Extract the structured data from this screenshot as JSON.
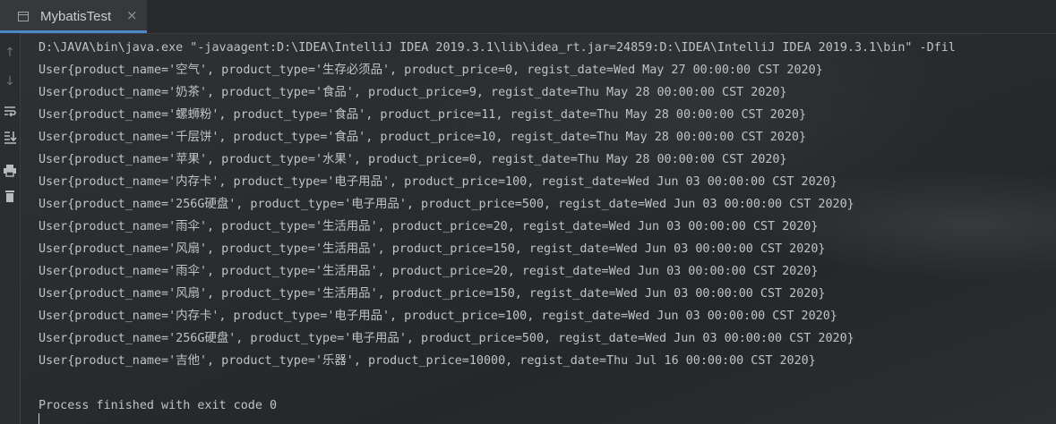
{
  "tab": {
    "label": "MybatisTest",
    "close": "×"
  },
  "gutter": {
    "icons": [
      "arrow-up-icon",
      "arrow-down-icon",
      "soft-wrap-icon",
      "scroll-to-end-icon",
      "print-icon",
      "trash-icon"
    ]
  },
  "console": {
    "command": "D:\\JAVA\\bin\\java.exe \"-javaagent:D:\\IDEA\\IntelliJ IDEA 2019.3.1\\lib\\idea_rt.jar=24859:D:\\IDEA\\IntelliJ IDEA 2019.3.1\\bin\" -Dfil",
    "output": [
      "User{product_name='空气', product_type='生存必须品', product_price=0, regist_date=Wed May 27 00:00:00 CST 2020}",
      "User{product_name='奶茶', product_type='食品', product_price=9, regist_date=Thu May 28 00:00:00 CST 2020}",
      "User{product_name='螺蛳粉', product_type='食品', product_price=11, regist_date=Thu May 28 00:00:00 CST 2020}",
      "User{product_name='千层饼', product_type='食品', product_price=10, regist_date=Thu May 28 00:00:00 CST 2020}",
      "User{product_name='苹果', product_type='水果', product_price=0, regist_date=Thu May 28 00:00:00 CST 2020}",
      "User{product_name='内存卡', product_type='电子用品', product_price=100, regist_date=Wed Jun 03 00:00:00 CST 2020}",
      "User{product_name='256G硬盘', product_type='电子用品', product_price=500, regist_date=Wed Jun 03 00:00:00 CST 2020}",
      "User{product_name='雨伞', product_type='生活用品', product_price=20, regist_date=Wed Jun 03 00:00:00 CST 2020}",
      "User{product_name='风扇', product_type='生活用品', product_price=150, regist_date=Wed Jun 03 00:00:00 CST 2020}",
      "User{product_name='雨伞', product_type='生活用品', product_price=20, regist_date=Wed Jun 03 00:00:00 CST 2020}",
      "User{product_name='风扇', product_type='生活用品', product_price=150, regist_date=Wed Jun 03 00:00:00 CST 2020}",
      "User{product_name='内存卡', product_type='电子用品', product_price=100, regist_date=Wed Jun 03 00:00:00 CST 2020}",
      "User{product_name='256G硬盘', product_type='电子用品', product_price=500, regist_date=Wed Jun 03 00:00:00 CST 2020}",
      "User{product_name='吉他', product_type='乐器', product_price=10000, regist_date=Thu Jul 16 00:00:00 CST 2020}"
    ],
    "exit_message": "Process finished with exit code 0"
  }
}
